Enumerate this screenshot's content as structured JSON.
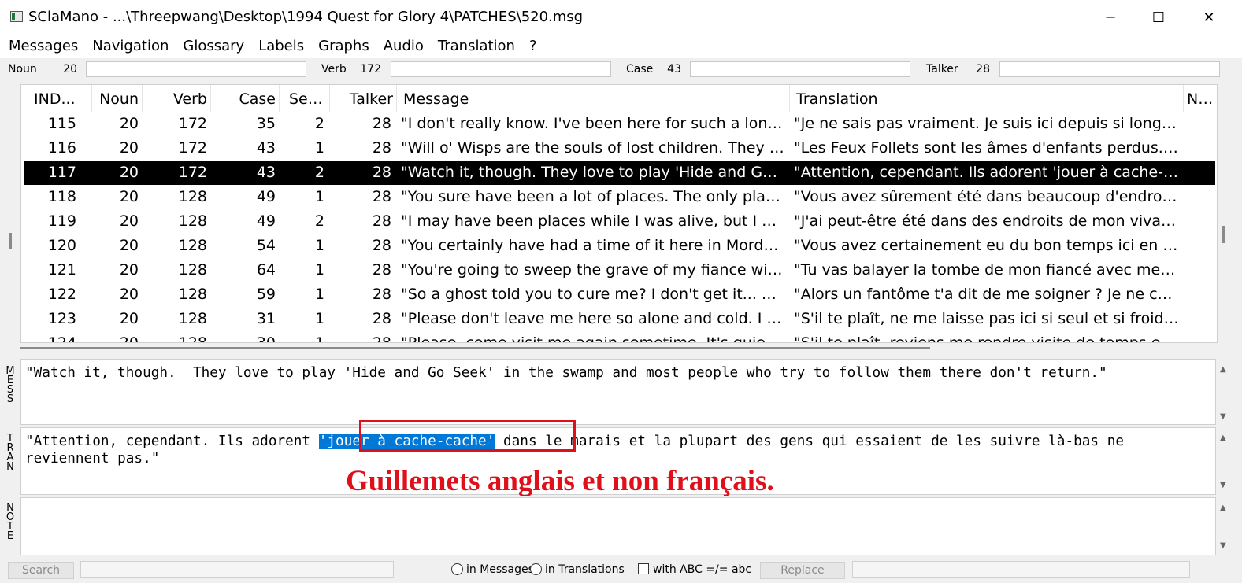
{
  "window": {
    "title": "SClaMano - ...\\Threepwang\\Desktop\\1994 Quest for Glory 4\\PATCHES\\520.msg",
    "minimize": "─",
    "maximize": "☐",
    "close": "✕"
  },
  "menu": [
    "Messages",
    "Navigation",
    "Glossary",
    "Labels",
    "Graphs",
    "Audio",
    "Translation",
    "?"
  ],
  "filters": {
    "noun_label": "Noun",
    "noun_value": "20",
    "verb_label": "Verb",
    "verb_value": "172",
    "case_label": "Case",
    "case_value": "43",
    "talker_label": "Talker",
    "talker_value": "28"
  },
  "table": {
    "columns": [
      "IND...",
      "Noun",
      "Verb",
      "Case",
      "Seq...",
      "Talker",
      "Message",
      "Translation",
      "Note"
    ],
    "rows": [
      [
        "115",
        "20",
        "172",
        "35",
        "2",
        "28",
        "\"I don't really know.  I've been here for such a long tim...",
        "\"Je ne sais pas vraiment. Je suis ici depuis si longtemps..."
      ],
      [
        "116",
        "20",
        "172",
        "43",
        "1",
        "28",
        "\"Will o' Wisps are the souls of lost children.  They play ...",
        "\"Les Feux Follets sont les âmes d'enfants perdus. Ils jo..."
      ],
      [
        "117",
        "20",
        "172",
        "43",
        "2",
        "28",
        "\"Watch it, though.  They love to play 'Hide and Go Seek...",
        "\"Attention, cependant. Ils adorent 'jouer à cache-cache'..."
      ],
      [
        "118",
        "20",
        "128",
        "49",
        "1",
        "28",
        "\"You sure have been a lot of places.  The only place I've...",
        "\"Vous avez sûrement été dans beaucoup d'endroits. Le..."
      ],
      [
        "119",
        "20",
        "128",
        "49",
        "2",
        "28",
        "\"I may have been places while I was alive, but I can't re...",
        "\"J'ai peut-être été dans des endroits de mon vivant, ma..."
      ],
      [
        "120",
        "20",
        "128",
        "54",
        "1",
        "28",
        "\"You certainly have had a time of it here in Mordavia.  ...",
        "\"Vous avez certainement eu du bon temps ici en Mord..."
      ],
      [
        "121",
        "20",
        "128",
        "64",
        "1",
        "28",
        "\"You're going to sweep the grave of my fiance with my...",
        "\"Tu vas balayer la tombe de mon fiancé avec mes chev..."
      ],
      [
        "122",
        "20",
        "128",
        "59",
        "1",
        "28",
        "\"So a ghost told you to cure me?  I don't get it... Why s...",
        "\"Alors un fantôme t'a dit de me soigner ? Je ne compre..."
      ],
      [
        "123",
        "20",
        "128",
        "31",
        "1",
        "28",
        "\"Please don't leave me here so alone and cold.  I need ...",
        "\"S'il te plaît, ne me laisse pas ici si seul et si froid. J'ai b..."
      ],
      [
        "124",
        "20",
        "128",
        "30",
        "1",
        "28",
        "\"Please, come visit me again sometime.  It's quiet, alo...",
        "\"S'il te plaît, reviens me rendre visite de temps en temps..."
      ]
    ]
  },
  "panes": {
    "message_label": "M\nE\nS\nS",
    "message_text": "\"Watch it, though.  They love to play 'Hide and Go Seek' in the swamp and most people who try to follow them there don't return.\"",
    "translation_label": "T\nR\nA\nN",
    "translation_before": "\"Attention, cependant. Ils adorent ",
    "translation_highlight": "'jouer à cache-cache'",
    "translation_after": " dans le marais et la plupart des gens qui essaient de les suivre là-bas ne reviennent pas.\"",
    "note_label": "N\nO\nT\nE",
    "note_text": "",
    "scroll_up": "▲",
    "scroll_down": "▼"
  },
  "annotation": "Guillemets anglais et non français.",
  "statusbar": {
    "search": "Search",
    "in_messages": "in Messages",
    "in_translations": "in Translations",
    "case_option": "with ABC =/= abc",
    "replace": "Replace"
  },
  "colors": {
    "selection": "#000000",
    "highlight": "#0078d7",
    "annotation": "#e0101a"
  }
}
